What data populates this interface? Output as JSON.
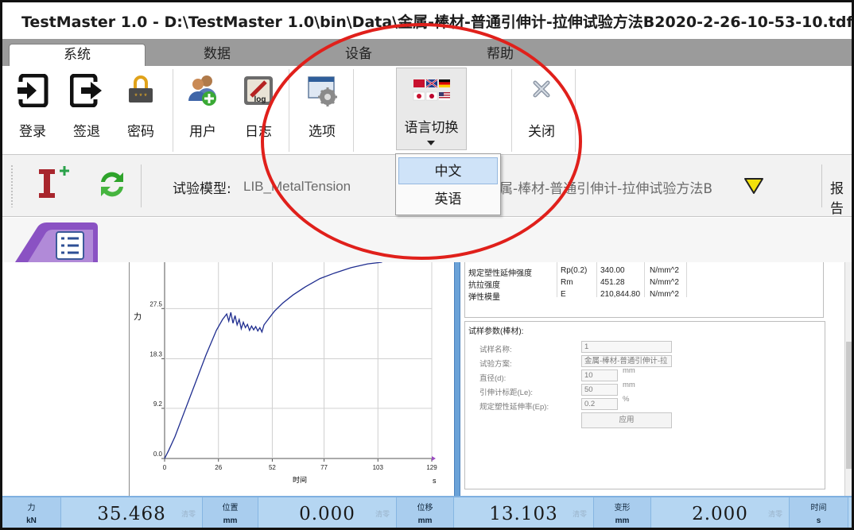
{
  "window": {
    "title": "TestMaster 1.0 - D:\\TestMaster 1.0\\bin\\Data\\金属-棒材-普通引伸计-拉伸试验方法B2020-2-26-10-53-10.tdf"
  },
  "menu": {
    "tabs": [
      {
        "label": "系统",
        "active": true
      },
      {
        "label": "数据",
        "active": false
      },
      {
        "label": "设备",
        "active": false
      },
      {
        "label": "帮助",
        "active": false
      }
    ]
  },
  "ribbon": {
    "login": "登录",
    "logout": "签退",
    "password": "密码",
    "user": "用户",
    "log": "日志",
    "options": "选项",
    "language": "语言切换",
    "close": "关闭",
    "log_icon_text": "log"
  },
  "language_menu": {
    "items": [
      {
        "label": "中文",
        "selected": true
      },
      {
        "label": "英语",
        "selected": false
      }
    ]
  },
  "toolbar": {
    "model_label": "试验模型:",
    "model_value": "LIB_MetalTension",
    "method_value": "属-棒材-普通引伸计-拉伸试验方法B",
    "report_label": "报告"
  },
  "chart_data": {
    "type": "line",
    "ylabel": "力",
    "xlabel": "时间",
    "x_unit": "s",
    "x_ticks": [
      "0",
      "26",
      "52",
      "77",
      "103",
      "129"
    ],
    "y_ticks": [
      "0.0",
      "9.2",
      "18.3",
      "27.5"
    ],
    "xlim": [
      0,
      129
    ],
    "ylim": [
      0,
      36
    ],
    "grid": true,
    "series": [
      {
        "color": "#1f2d8f",
        "points": [
          [
            0,
            0
          ],
          [
            2,
            1.5
          ],
          [
            5,
            4
          ],
          [
            10,
            9
          ],
          [
            15,
            14
          ],
          [
            20,
            19
          ],
          [
            25,
            23.5
          ],
          [
            28,
            25.5
          ],
          [
            30,
            26.5
          ],
          [
            31,
            25.2
          ],
          [
            32,
            26.8
          ],
          [
            33,
            24.8
          ],
          [
            34,
            26.2
          ],
          [
            35,
            24.5
          ],
          [
            36,
            25.5
          ],
          [
            37,
            23.8
          ],
          [
            38,
            25
          ],
          [
            39,
            24
          ],
          [
            40,
            24.6
          ],
          [
            41,
            23.5
          ],
          [
            42,
            24.3
          ],
          [
            43,
            23.6
          ],
          [
            44,
            24.2
          ],
          [
            45,
            23.4
          ],
          [
            46,
            24
          ],
          [
            47,
            23.2
          ],
          [
            48,
            24.5
          ],
          [
            50,
            25.5
          ],
          [
            53,
            27
          ],
          [
            57,
            28.5
          ],
          [
            62,
            30
          ],
          [
            68,
            31.5
          ],
          [
            75,
            33
          ],
          [
            82,
            34
          ],
          [
            90,
            35
          ],
          [
            98,
            35.7
          ],
          [
            105,
            36
          ]
        ]
      }
    ]
  },
  "results": {
    "rows": [
      {
        "name": "规定塑性延伸强度",
        "symbol": "Rp(0.2)",
        "value": "340.00",
        "unit": "N/mm^2"
      },
      {
        "name": "抗拉强度",
        "symbol": "Rm",
        "value": "451.28",
        "unit": "N/mm^2"
      },
      {
        "name": "弹性模量",
        "symbol": "E",
        "value": "210,844.80",
        "unit": "N/mm^2"
      }
    ]
  },
  "params": {
    "title": "试样参数(棒材):",
    "fields": [
      {
        "label": "试样名称:",
        "value": "1",
        "unit": ""
      },
      {
        "label": "试验方案:",
        "value": "金属-棒材-普通引伸计-拉",
        "unit": ""
      },
      {
        "label": "直径(d):",
        "value": "10",
        "unit": "mm"
      },
      {
        "label": "引伸计标距(Le):",
        "value": "50",
        "unit": "mm"
      },
      {
        "label": "规定塑性延伸率(Ep):",
        "value": "0.2",
        "unit": "%"
      }
    ],
    "apply": "应用"
  },
  "status": {
    "zero_label": "清零",
    "channels": [
      {
        "name": "力",
        "unit": "kN",
        "value": "35.468"
      },
      {
        "name": "位置",
        "unit": "mm",
        "value": "0.000"
      },
      {
        "name": "位移",
        "unit": "mm",
        "value": "13.103"
      },
      {
        "name": "变形",
        "unit": "mm",
        "value": "2.000"
      },
      {
        "name": "时间",
        "unit": "s",
        "value": ""
      }
    ]
  },
  "colors": {
    "annotation": "#e0201b",
    "statusbar": "#b5d6f2",
    "selection": "#cfe3f8"
  }
}
